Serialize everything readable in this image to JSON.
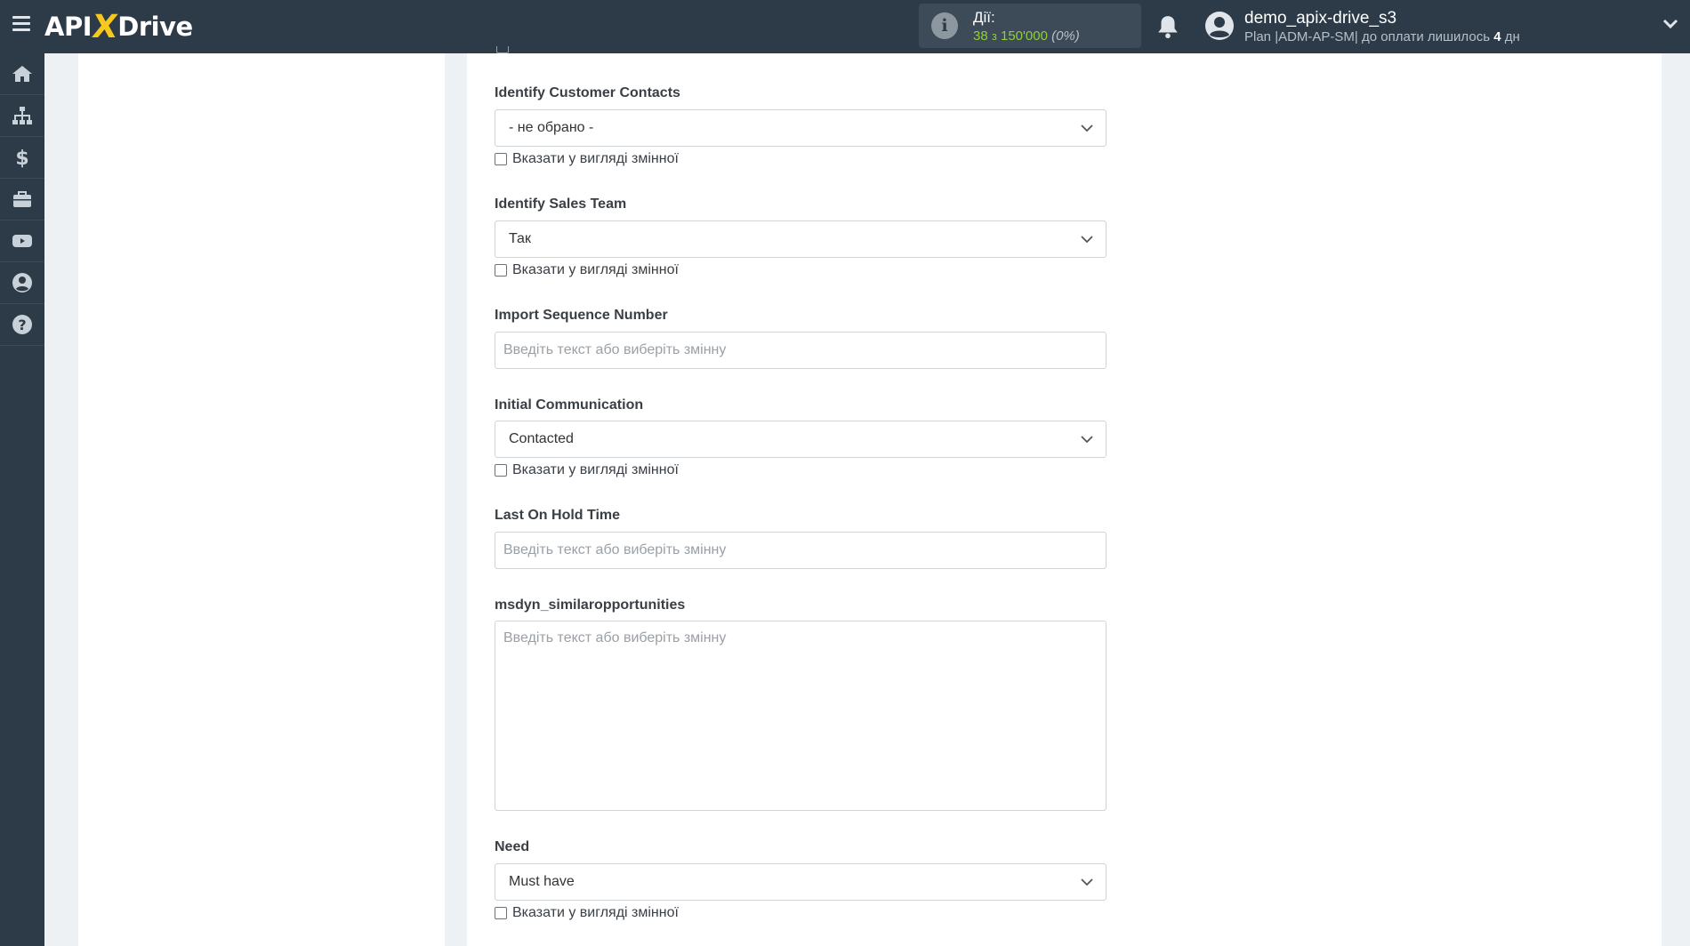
{
  "header": {
    "logo": {
      "left": "API",
      "x": "X",
      "right": "Drive"
    },
    "actions": {
      "label": "Дії:",
      "used": "38",
      "sep": "з",
      "total": "150'000",
      "percent": "(0%)"
    },
    "user": {
      "name": "demo_apix-drive_s3",
      "plan_prefix": "Plan |ADM-AP-SM| до оплати лишилось",
      "days": "4",
      "days_unit": "дн"
    }
  },
  "sidebar": {
    "items": [
      {
        "name": "home",
        "icon": "home-icon"
      },
      {
        "name": "connections",
        "icon": "sitemap-icon"
      },
      {
        "name": "billing",
        "icon": "dollar-icon"
      },
      {
        "name": "tools",
        "icon": "briefcase-icon"
      },
      {
        "name": "video",
        "icon": "youtube-icon"
      },
      {
        "name": "profile",
        "icon": "user-circle-icon"
      },
      {
        "name": "help",
        "icon": "question-icon"
      }
    ]
  },
  "form": {
    "checkbox_label": "Вказати у вигляді змінної",
    "placeholder": "Введіть текст або виберіть змінну",
    "fields": {
      "identify_customer_contacts": {
        "label": "Identify Customer Contacts",
        "value": "- не обрано -"
      },
      "identify_sales_team": {
        "label": "Identify Sales Team",
        "value": "Так"
      },
      "import_sequence_number": {
        "label": "Import Sequence Number"
      },
      "initial_communication": {
        "label": "Initial Communication",
        "value": "Contacted"
      },
      "last_on_hold_time": {
        "label": "Last On Hold Time"
      },
      "similar_opportunities": {
        "label": "msdyn_similaropportunities"
      },
      "need": {
        "label": "Need",
        "value": "Must have"
      }
    }
  },
  "colors": {
    "topbar": "#2d3a47",
    "accent": "#f7c81e",
    "actions_green": "#8fcf3c",
    "background": "#eef1f4"
  }
}
